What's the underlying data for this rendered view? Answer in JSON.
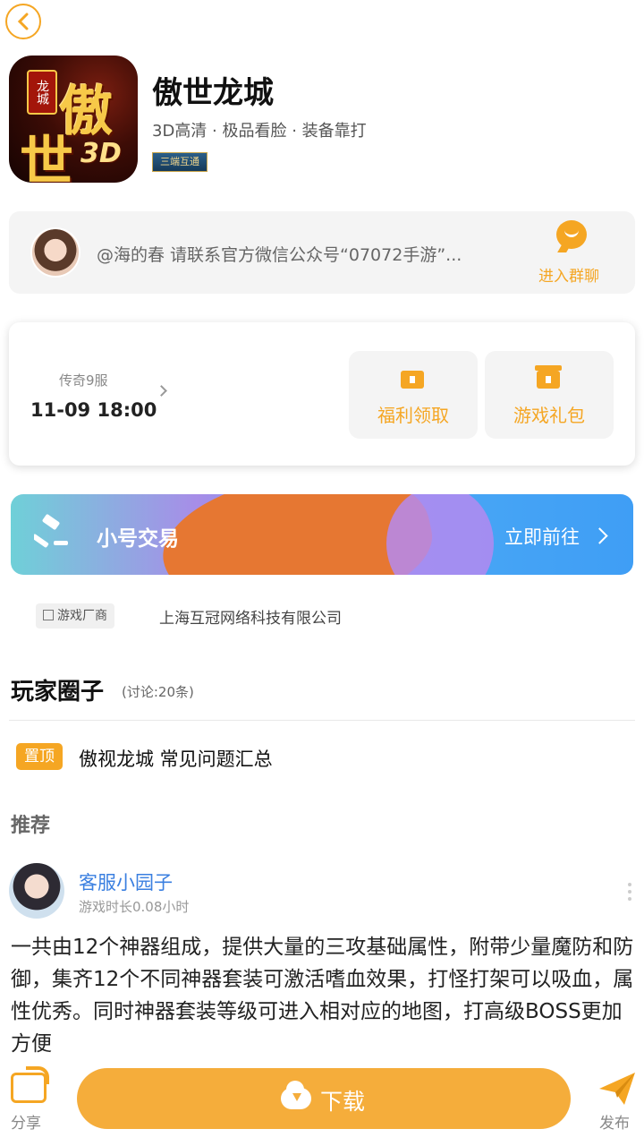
{
  "app": {
    "icon_text": [
      "傲",
      "世",
      "3D"
    ],
    "icon_badge": "龙城",
    "title": "傲世龙城",
    "subtitle": "3D高清 · 极品看脸 · 装备靠打",
    "tag": "三端互通"
  },
  "notice": {
    "text": "@海的春 请联系官方微信公众号“07072手游”...",
    "group_label": "进入群聊"
  },
  "server": {
    "name": "传奇9服",
    "time": "11-09 18:00",
    "welfare_label": "福利领取",
    "gift_label": "游戏礼包"
  },
  "banner": {
    "title": "小号交易",
    "action": "立即前往"
  },
  "developer": {
    "label": "游戏厂商",
    "name": "上海互冠网络科技有限公司"
  },
  "circle": {
    "title": "玩家圈子",
    "count": "(讨论:20条)",
    "pinned_badge": "置顶",
    "pinned_text": "傲视龙城  常见问题汇总",
    "recommend_label": "推荐"
  },
  "post": {
    "user": "客服小园子",
    "meta": "游戏时长0.08小时",
    "body": "一共由12个神器组成，提供大量的三攻基础属性，附带少量魔防和防御，集齐12个不同神器套装可激活嗜血效果，打怪打架可以吸血，属性优秀。同时神器套装等级可进入相对应的地图，打高级BOSS更加方便"
  },
  "bottom": {
    "share_label": "分享",
    "download_label": "下载",
    "publish_label": "发布"
  },
  "colors": {
    "accent": "#f5a623",
    "link": "#3a7fe0"
  }
}
